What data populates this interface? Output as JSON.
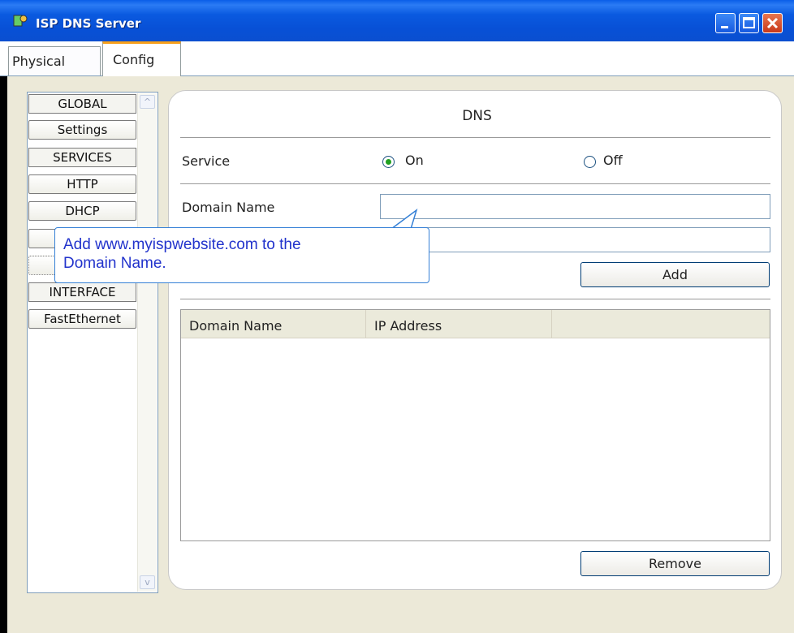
{
  "window": {
    "title": "ISP DNS Server",
    "buttons": [
      "minimize",
      "maximize",
      "close"
    ]
  },
  "tabs": [
    {
      "label": "Physical"
    },
    {
      "label": "Config"
    }
  ],
  "sidebar": {
    "items": [
      {
        "label": "GLOBAL"
      },
      {
        "label": "Settings"
      },
      {
        "label": "SERVICES"
      },
      {
        "label": "HTTP"
      },
      {
        "label": "DHCP"
      },
      {
        "label": ""
      },
      {
        "label": ""
      },
      {
        "label": "INTERFACE"
      },
      {
        "label": "FastEthernet"
      }
    ]
  },
  "dns": {
    "title": "DNS",
    "service_label": "Service",
    "on_label": "On",
    "off_label": "Off",
    "service_value": "On",
    "domain_name_label": "Domain Name",
    "domain_name_value": "",
    "address_value": "",
    "add_button": "Add",
    "remove_button": "Remove",
    "table": {
      "columns": [
        "Domain Name",
        "IP Address"
      ],
      "rows": []
    }
  },
  "tooltip": {
    "lines": [
      "Add www.myispwebsite.com to the",
      "Domain Name."
    ]
  },
  "colors": {
    "titlebar": "#0a54dc",
    "tab_accent": "#f7a01b",
    "tooltip_text": "#2233cc",
    "radio_checked": "#21a121"
  }
}
